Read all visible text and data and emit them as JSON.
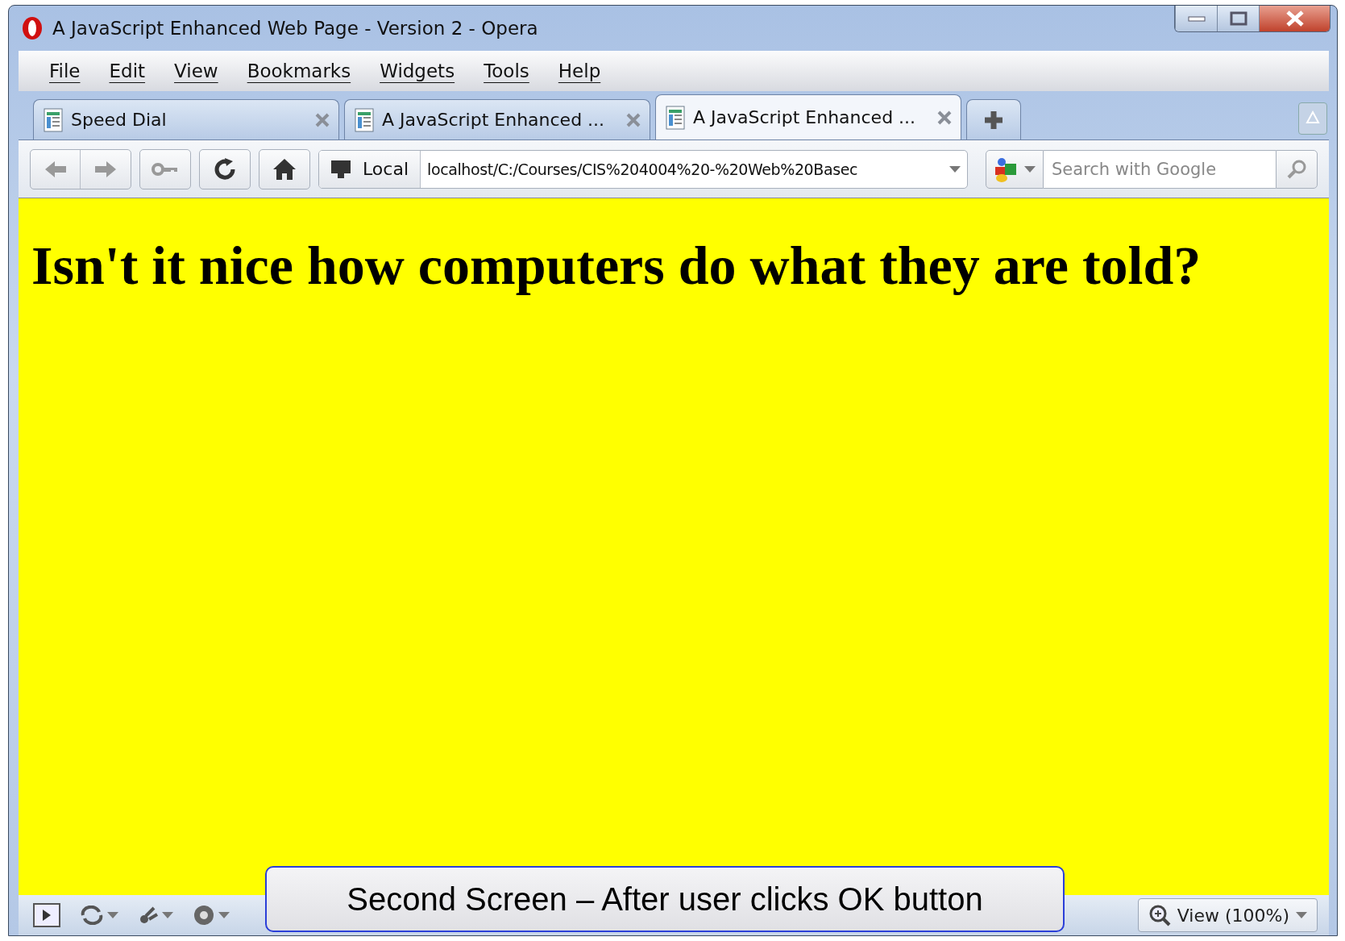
{
  "window": {
    "title": "A JavaScript Enhanced Web Page - Version 2 - Opera"
  },
  "menu": [
    {
      "label": "File"
    },
    {
      "label": "Edit"
    },
    {
      "label": "View"
    },
    {
      "label": "Bookmarks"
    },
    {
      "label": "Widgets"
    },
    {
      "label": "Tools"
    },
    {
      "label": "Help"
    }
  ],
  "tabs": [
    {
      "label": "Speed Dial",
      "selected": false
    },
    {
      "label": "A JavaScript Enhanced ...",
      "selected": false
    },
    {
      "label": "A JavaScript Enhanced ...",
      "selected": true
    }
  ],
  "address_bar": {
    "badge": "Local",
    "value": "localhost/C:/Courses/CIS%204004%20-%20Web%20Basec"
  },
  "search": {
    "placeholder": "Search with Google"
  },
  "page": {
    "heading": "Isn't it nice how computers do what they are told?"
  },
  "status_bar": {
    "zoom": "View (100%)"
  },
  "callout": {
    "text": "Second Screen – After user clicks OK button"
  }
}
